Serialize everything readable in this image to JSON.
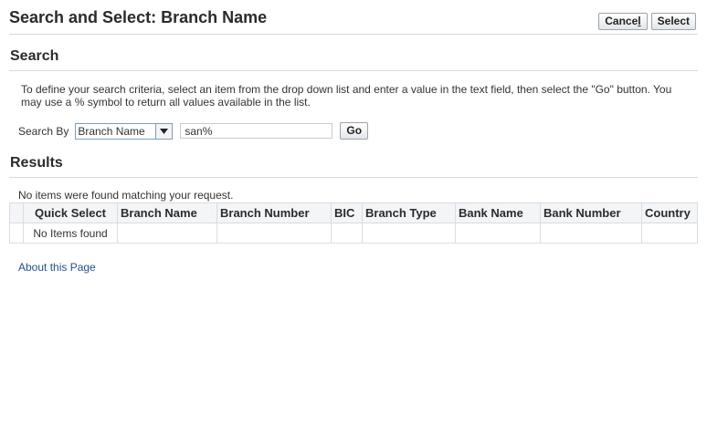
{
  "header": {
    "title": "Search and Select: Branch Name",
    "cancel_label_pre": "Cance",
    "cancel_label_access": "l",
    "select_label": "Select"
  },
  "search": {
    "heading": "Search",
    "instructions": "To define your search criteria, select an item from the drop down list and enter a value in the text field, then select the \"Go\" button. You may use a % symbol to return all values available in the list.",
    "search_by_label": "Search By",
    "search_by_value": "Branch Name",
    "query_value": "san%",
    "go_label": "Go"
  },
  "results": {
    "heading": "Results",
    "message": "No items were found matching your request.",
    "columns": [
      "",
      "Quick Select",
      "Branch Name",
      "Branch Number",
      "BIC",
      "Branch Type",
      "Bank Name",
      "Bank Number",
      "Country"
    ],
    "empty_text": "No Items found"
  },
  "footer": {
    "about_link": "About this Page"
  }
}
